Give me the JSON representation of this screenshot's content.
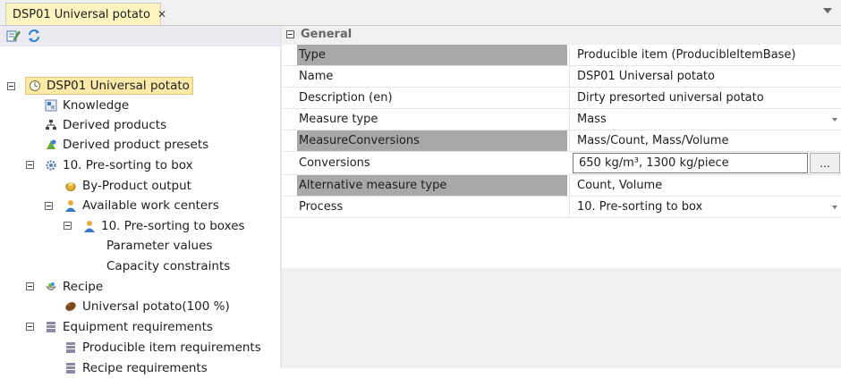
{
  "tab": {
    "title": "DSP01 Universal potato",
    "close_symbol": "✕"
  },
  "toolbar": {
    "edit_icon": "edit-icon",
    "refresh_icon": "refresh-icon"
  },
  "tree": {
    "root": "DSP01 Universal potato",
    "knowledge": "Knowledge",
    "derived_products": "Derived products",
    "derived_product_presets": "Derived product presets",
    "presorting": "10. Pre-sorting to box",
    "byproduct_output": "By-Product output",
    "available_work_centers": "Available work centers",
    "presorting_boxes": "10. Pre-sorting to boxes",
    "parameter_values": "Parameter values",
    "capacity_constraints": "Capacity constraints",
    "recipe": "Recipe",
    "universal_potato": "Universal potato(100 %)",
    "equipment_requirements": "Equipment requirements",
    "producible_item_requirements": "Producible item requirements",
    "recipe_requirements": "Recipe requirements"
  },
  "properties": {
    "group": "General",
    "rows": [
      {
        "name": "Type",
        "value": "Producible item (ProducibleItemBase)",
        "readonly": true
      },
      {
        "name": "Name",
        "value": "DSP01 Universal potato",
        "readonly": false
      },
      {
        "name": "Description (en)",
        "value": "Dirty presorted universal potato",
        "readonly": false
      },
      {
        "name": "Measure type",
        "value": "Mass",
        "readonly": false
      },
      {
        "name": "MeasureConversions",
        "value": "Mass/Count, Mass/Volume",
        "readonly": true
      },
      {
        "name": "Conversions",
        "value": "650 kg/m³, 1300 kg/piece",
        "readonly": false
      },
      {
        "name": "Alternative measure type",
        "value": "Count, Volume",
        "readonly": true
      },
      {
        "name": "Process",
        "value": "10. Pre-sorting to box",
        "readonly": false
      }
    ],
    "ellipsis_label": "..."
  },
  "colors": {
    "selection": "#fde9a8",
    "tab_active": "#fdf4bf",
    "readonly_name": "#a8a8a8"
  }
}
